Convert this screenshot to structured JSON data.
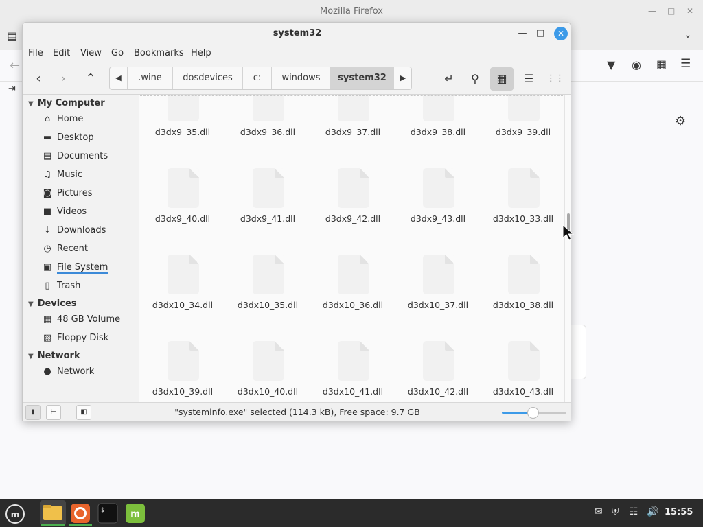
{
  "firefox": {
    "window_title": "Mozilla Firefox"
  },
  "nemo": {
    "window_title": "system32",
    "menu": [
      "File",
      "Edit",
      "View",
      "Go",
      "Bookmarks",
      "Help"
    ],
    "breadcrumbs": [
      ".wine",
      "dosdevices",
      "c:",
      "windows",
      "system32"
    ],
    "active_crumb": "system32",
    "sidebar": {
      "sections": [
        {
          "title": "My Computer",
          "items": [
            {
              "label": "Home",
              "icon": "home-icon"
            },
            {
              "label": "Desktop",
              "icon": "desktop-icon"
            },
            {
              "label": "Documents",
              "icon": "documents-icon"
            },
            {
              "label": "Music",
              "icon": "music-icon"
            },
            {
              "label": "Pictures",
              "icon": "camera-icon"
            },
            {
              "label": "Videos",
              "icon": "folder-icon"
            },
            {
              "label": "Downloads",
              "icon": "download-icon"
            },
            {
              "label": "Recent",
              "icon": "clock-icon"
            },
            {
              "label": "File System",
              "icon": "drive-icon"
            },
            {
              "label": "Trash",
              "icon": "trash-icon"
            }
          ]
        },
        {
          "title": "Devices",
          "items": [
            {
              "label": "48 GB Volume",
              "icon": "chip-icon"
            },
            {
              "label": "Floppy Disk",
              "icon": "floppy-icon"
            }
          ]
        },
        {
          "title": "Network",
          "items": [
            {
              "label": "Network",
              "icon": "globe-icon"
            }
          ]
        }
      ]
    },
    "files": [
      "d3dx9_35.dll",
      "d3dx9_36.dll",
      "d3dx9_37.dll",
      "d3dx9_38.dll",
      "d3dx9_39.dll",
      "d3dx9_40.dll",
      "d3dx9_41.dll",
      "d3dx9_42.dll",
      "d3dx9_43.dll",
      "d3dx10_33.dll",
      "d3dx10_34.dll",
      "d3dx10_35.dll",
      "d3dx10_36.dll",
      "d3dx10_37.dll",
      "d3dx10_38.dll",
      "d3dx10_39.dll",
      "d3dx10_40.dll",
      "d3dx10_41.dll",
      "d3dx10_42.dll",
      "d3dx10_43.dll"
    ],
    "status_text": "\"systeminfo.exe\" selected (114.3 kB), Free space: 9.7 GB",
    "zoom_level_fraction": 0.48,
    "accent_color": "#3c9ae8"
  },
  "taskbar": {
    "clock": "15:55",
    "apps": [
      "mint-menu-icon",
      "files-icon",
      "firefox-icon",
      "terminal-icon",
      "mintinstall-icon"
    ]
  }
}
